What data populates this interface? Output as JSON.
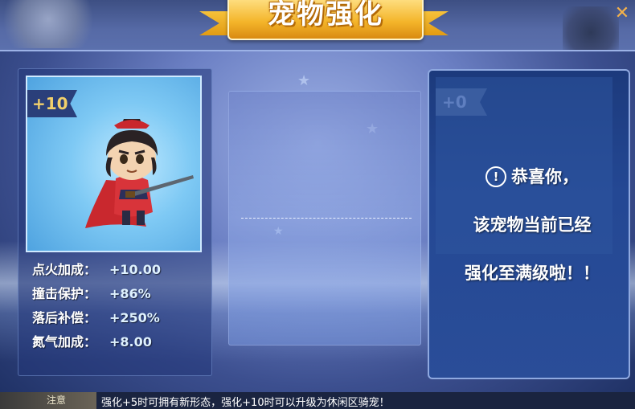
{
  "title": "宠物强化",
  "close_label": "✕",
  "left_panel": {
    "level_tag": "+10",
    "stats": [
      {
        "label": "点火加成：",
        "value": "+10.00"
      },
      {
        "label": "撞击保护：",
        "value": "+86%"
      },
      {
        "label": "落后补偿：",
        "value": "+250%"
      },
      {
        "label": "氮气加成：",
        "value": "+8.00"
      }
    ]
  },
  "right_panel": {
    "level_tag": "+0",
    "icon": "!",
    "message_line1": "恭喜你，",
    "message_line2": "该宠物当前已经",
    "message_line3": "强化至满级啦！！"
  },
  "footer": {
    "left_label": "注意",
    "tip": "强化+5时可拥有新形态，强化+10时可以升级为休闲区骑宠！"
  },
  "colors": {
    "title_gold": "#f4b52a",
    "level_text": "#f2d06b",
    "close": "#f5b24a"
  }
}
